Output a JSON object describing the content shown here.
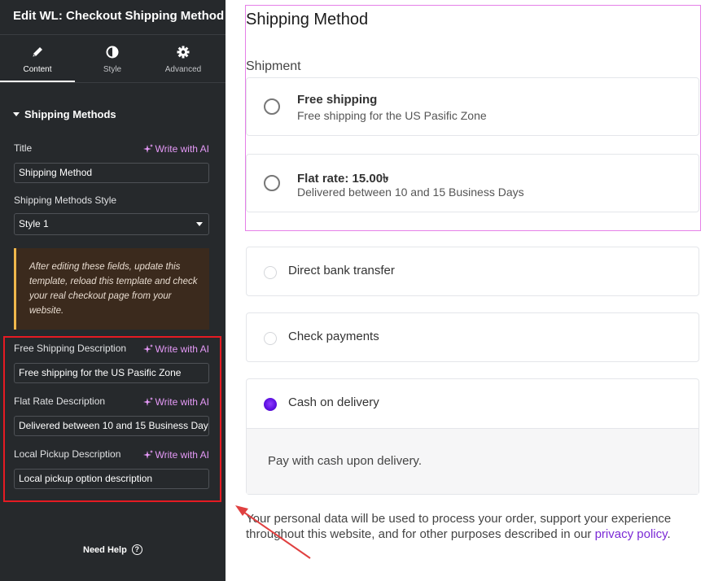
{
  "panel": {
    "title": "Edit WL: Checkout Shipping Method",
    "tabs": [
      {
        "label": "Content",
        "icon": "pencil-icon",
        "active": true
      },
      {
        "label": "Style",
        "icon": "contrast-icon",
        "active": false
      },
      {
        "label": "Advanced",
        "icon": "gear-icon",
        "active": false
      }
    ],
    "section": "Shipping Methods",
    "ai_label": "Write with AI",
    "fields": {
      "title": {
        "label": "Title",
        "value": "Shipping Method"
      },
      "style": {
        "label": "Shipping Methods Style",
        "value": "Style 1"
      },
      "notice": "After editing these fields, update this template, reload this template and check your real checkout page from your website.",
      "free_desc": {
        "label": "Free Shipping Description",
        "value": "Free shipping for the US Pasific Zone"
      },
      "flat_desc": {
        "label": "Flat Rate Description",
        "value": "Delivered between 10 and 15 Business Days"
      },
      "local_desc": {
        "label": "Local Pickup Description",
        "value": "Local pickup option description"
      }
    },
    "need_help": "Need Help"
  },
  "preview": {
    "title": "Shipping Method",
    "subtitle": "Shipment",
    "shipping_options": [
      {
        "name": "Free shipping",
        "desc": "Free shipping for the US Pasific Zone"
      },
      {
        "name": "Flat rate: 15.00৳",
        "desc": "Delivered between 10 and 15 Business Days"
      }
    ],
    "payments": [
      {
        "name": "Direct bank transfer",
        "selected": false
      },
      {
        "name": "Check payments",
        "selected": false
      },
      {
        "name": "Cash on delivery",
        "selected": true,
        "desc": "Pay with cash upon delivery."
      }
    ],
    "privacy_text": "Your personal data will be used to process your order, support your experience throughout this website, and for other purposes described in our ",
    "privacy_link": "privacy policy",
    "privacy_end": "."
  },
  "colors": {
    "panel_bg": "#26292c",
    "ai_accent": "#e599f7",
    "highlight_red": "#e51b23",
    "highlight_pink": "#e580e8",
    "radio_selected": "#5b0ee0",
    "link": "#7b2ad6"
  }
}
